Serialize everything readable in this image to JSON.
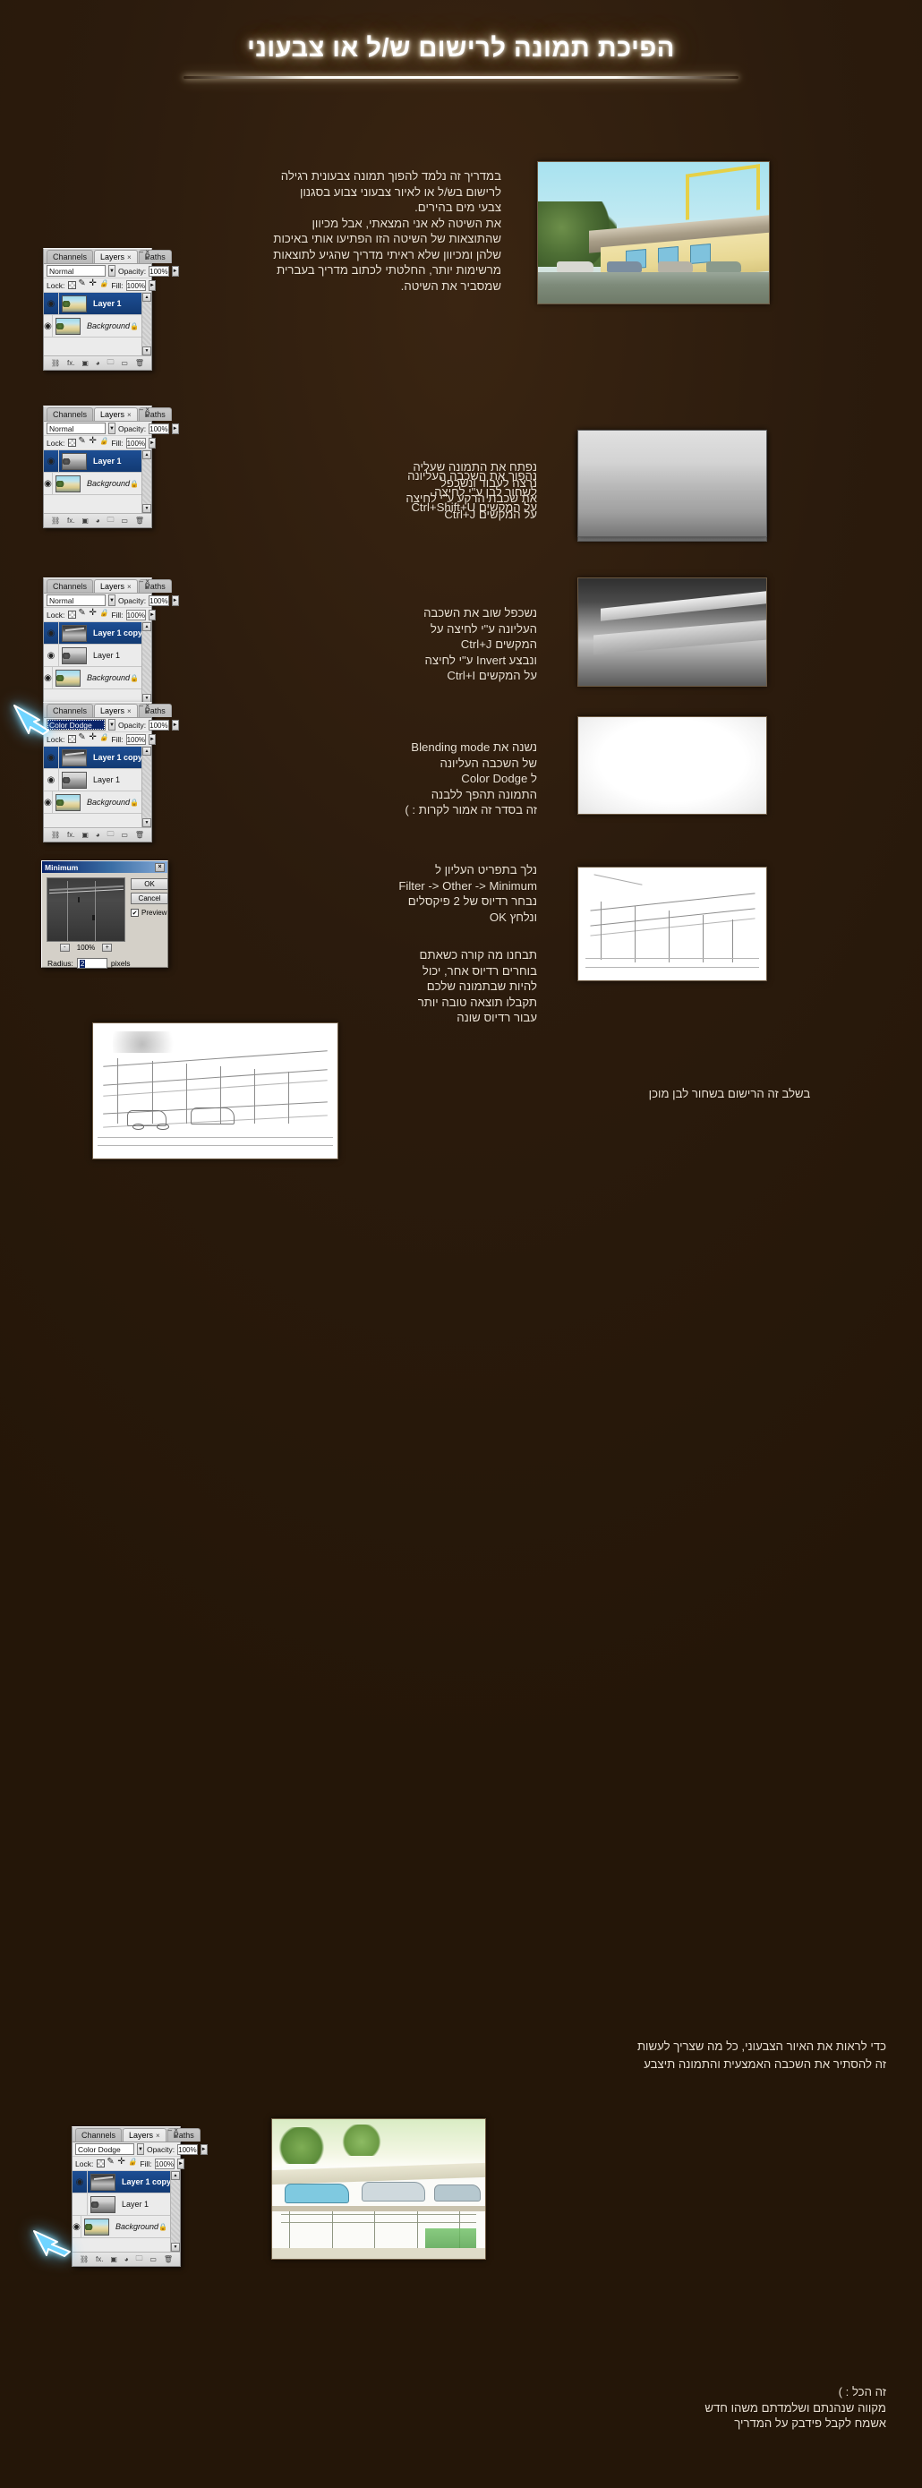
{
  "title": "הפיכת תמונה לרישום ש/ל או צבעוני",
  "intro": "במדריך זה נלמד להפוך תמונה צבעונית רגילה\nלרישום בש/ל או לאיור צבעוני צבוע בסגנון\nצבעי מים בהירים.\nאת השיטה לא אני המצאתי, אבל מכיוון\nשהתוצאות של השיטה הזו הפתיעו אותי באיכות\nשלהן ומכיוון שלא ראיתי מדריך שהגיע לתוצאות\nמרשימות יותר, החלטתי לכתוב מדריך בעברית\nשמסביר את השיטה.",
  "steps": [
    {
      "text": "נפתח את התמונה שעליה\nנרצה לעבוד ונשכפל\nאת שכבת הרקע ע\"י לחיצה\nעל המקשים Ctrl+J",
      "panel": {
        "tabs": [
          "Channels",
          "Layers",
          "Paths"
        ],
        "active_tab": "Layers",
        "blend_mode": "Normal",
        "opacity_label": "Opacity:",
        "opacity_value": "100%",
        "lock_label": "Lock:",
        "fill_label": "Fill:",
        "fill_value": "100%",
        "layers": [
          {
            "name": "Layer 1",
            "selected": true,
            "visible": true,
            "locked": false,
            "thumb": "color"
          },
          {
            "name": "Background",
            "selected": false,
            "visible": true,
            "locked": true,
            "italic": true,
            "thumb": "color"
          }
        ]
      }
    },
    {
      "text": "נהפוך את השכבה העליונה\nלשחור לבן ע\"י לחיצה\nעל המקשים Ctrl+Shift+U",
      "panel": {
        "tabs": [
          "Channels",
          "Layers",
          "Paths"
        ],
        "active_tab": "Layers",
        "blend_mode": "Normal",
        "opacity_label": "Opacity:",
        "opacity_value": "100%",
        "lock_label": "Lock:",
        "fill_label": "Fill:",
        "fill_value": "100%",
        "layers": [
          {
            "name": "Layer 1",
            "selected": true,
            "visible": true,
            "locked": false,
            "thumb": "gray"
          },
          {
            "name": "Background",
            "selected": false,
            "visible": true,
            "locked": true,
            "italic": true,
            "thumb": "color"
          }
        ]
      }
    },
    {
      "text": "נשכפל שוב את השכבה\nהעליונה ע\"י לחיצה על\nהמקשים Ctrl+J\nונבצע Invert ע\"י לחיצה\nעל המקשים Ctrl+I",
      "panel": {
        "tabs": [
          "Channels",
          "Layers",
          "Paths"
        ],
        "active_tab": "Layers",
        "blend_mode": "Normal",
        "opacity_label": "Opacity:",
        "opacity_value": "100%",
        "lock_label": "Lock:",
        "fill_label": "Fill:",
        "fill_value": "100%",
        "layers": [
          {
            "name": "Layer 1 copy",
            "selected": true,
            "visible": true,
            "locked": false,
            "thumb": "inv"
          },
          {
            "name": "Layer 1",
            "selected": false,
            "visible": true,
            "locked": false,
            "thumb": "gray"
          },
          {
            "name": "Background",
            "selected": false,
            "visible": true,
            "locked": true,
            "italic": true,
            "thumb": "color"
          }
        ]
      }
    },
    {
      "text": "נשנה את Blending mode\nשל השכבה העליונה\nל Color Dodge\nהתמונה תהפך ללבנה\nזה בסדר זה אמור לקרות : )",
      "panel": {
        "tabs": [
          "Channels",
          "Layers",
          "Paths"
        ],
        "active_tab": "Layers",
        "blend_mode": "Color Dodge",
        "blend_highlight": true,
        "opacity_label": "Opacity:",
        "opacity_value": "100%",
        "lock_label": "Lock:",
        "fill_label": "Fill:",
        "fill_value": "100%",
        "layers": [
          {
            "name": "Layer 1 copy",
            "selected": true,
            "visible": true,
            "locked": false,
            "thumb": "inv"
          },
          {
            "name": "Layer 1",
            "selected": false,
            "visible": true,
            "locked": false,
            "thumb": "gray"
          },
          {
            "name": "Background",
            "selected": false,
            "visible": true,
            "locked": true,
            "italic": true,
            "thumb": "color"
          }
        ]
      }
    }
  ],
  "filter_step": {
    "text_primary": "נלך בתפריט העליון ל\nFilter -> Other -> Minimum\nנבחר רדיוס של 2 פיקסלים\nונלחץ OK",
    "text_secondary": "תבחנו מה קורה כשאתם\nבוחרים רדיוס אחר, יכול\nלהיות שבתמונה שלכם\nתקבלו תוצאה טובה יותר\nעבור רדיוס שונה",
    "dialog": {
      "title": "Minimum",
      "close": "×",
      "ok": "OK",
      "cancel": "Cancel",
      "preview_label": "Preview",
      "preview_checked": "✔",
      "zoom_out": "-",
      "zoom_in": "+",
      "zoom_level": "100%",
      "radius_label": "Radius:",
      "radius_value": "2",
      "radius_unit": "pixels"
    }
  },
  "sketch_caption": "בשלב זה הרישום בשחור לבן מוכן",
  "color_caption": "כדי לראות את האיור הצבעוני, כל מה שצריך לעשות\nזה להסתיר את השכבה האמצעית והתמונה תיצבע",
  "final_panel": {
    "tabs": [
      "Channels",
      "Layers",
      "Paths"
    ],
    "active_tab": "Layers",
    "blend_mode": "Color Dodge",
    "opacity_label": "Opacity:",
    "opacity_value": "100%",
    "lock_label": "Lock:",
    "fill_label": "Fill:",
    "fill_value": "100%",
    "layers": [
      {
        "name": "Layer 1 copy",
        "selected": true,
        "visible": true,
        "locked": false,
        "thumb": "inv"
      },
      {
        "name": "Layer 1",
        "selected": false,
        "visible": false,
        "locked": false,
        "thumb": "gray"
      },
      {
        "name": "Background",
        "selected": false,
        "visible": true,
        "locked": true,
        "italic": true,
        "thumb": "color"
      }
    ]
  },
  "closing": "זה הכל : )\nמקווה שנהנתם ושלמדתם משהו חדש\nאשמח לקבל פידבק על המדריך",
  "icons": {
    "eye": "◉",
    "lock": "🔒",
    "dropdown_arrow": "▼",
    "stepper_arrow": "►",
    "tab_close": "×",
    "scroll_up": "▲",
    "scroll_down": "▼",
    "win_min": "–",
    "win_close": "×",
    "panel_menu": "≡"
  },
  "colors": {
    "background": "#2a1a0c",
    "text": "#eae0d2",
    "title": "#ffffff",
    "selection": "#1d4e94",
    "arrow_glow": "#8ce1ff"
  }
}
